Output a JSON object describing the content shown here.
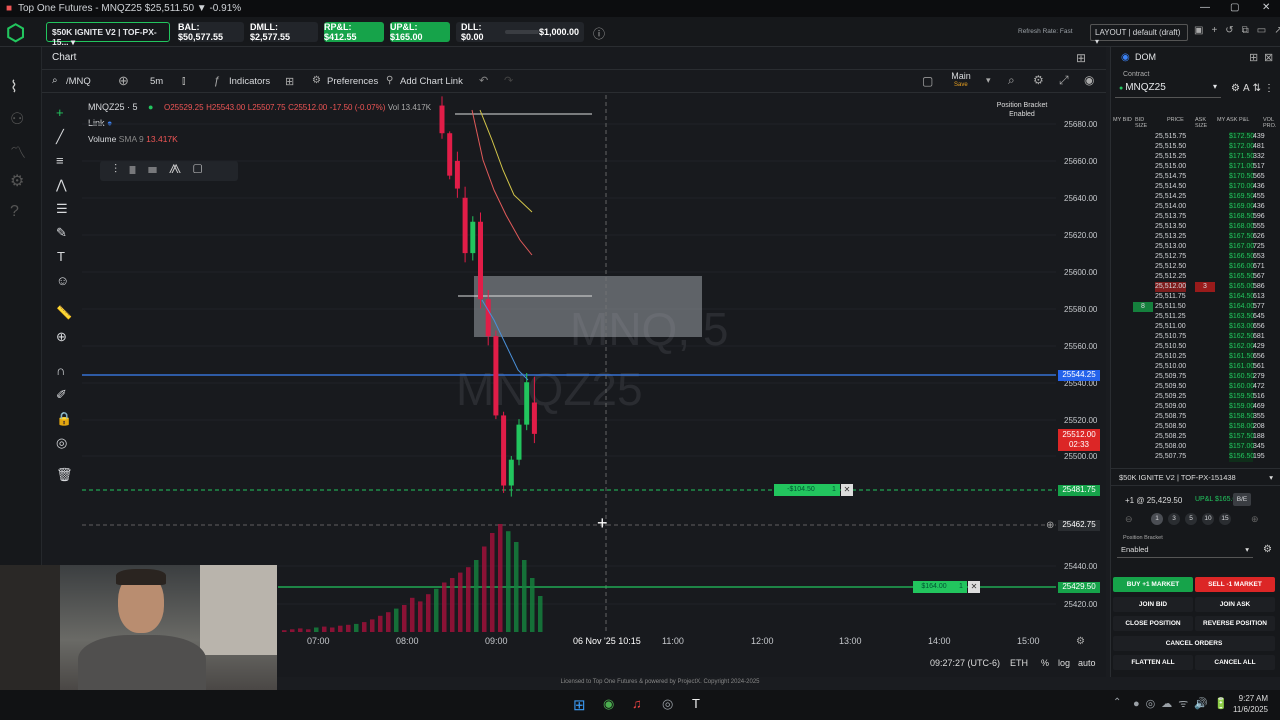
{
  "window": {
    "title": "Top One Futures - MNQZ25 $25,511.50 ▼ -0.91%"
  },
  "topbar": {
    "account": "$50K IGNITE V2 | TOF-PX-15...",
    "bal": "BAL: $50,577.55",
    "dmll": "DMLL: $2,577.55",
    "rpl": "RP&L: $412.55",
    "upl": "UP&L: $165.00",
    "dll": "DLL: $0.00",
    "dll_max": "$1,000.00",
    "refresh": "Refresh Rate: Fast",
    "layout": "LAYOUT | default (draft)"
  },
  "chart_panel": {
    "tab": "Chart",
    "symbol_search": "/MNQ",
    "interval": "5m",
    "indicators": "Indicators",
    "preferences": "Preferences",
    "add_chart_link": "Add Chart Link",
    "main_label": "Main",
    "main_sub": "Save",
    "position_bracket": "Position Bracket",
    "position_bracket_state": "Enabled"
  },
  "legend": {
    "symbol": "MNQZ25 · 5",
    "ohlc_o": "O25529.25",
    "ohlc_h": "H25543.00",
    "ohlc_l": "L25507.75",
    "ohlc_c": "C25512.00",
    "ohlc_change": "-17.50 (-0.07%)",
    "vol": "Vol 13.417K",
    "link": "Link",
    "volume_label": "Volume",
    "volume_sma": "SMA 9",
    "volume_value": "13.417K"
  },
  "watermark": {
    "line1": "MNQ, 5",
    "line2": "MNQZ25"
  },
  "chart_data": {
    "type": "candlestick",
    "symbol": "MNQZ25",
    "price_axis": [
      "25680.00",
      "25660.00",
      "25640.00",
      "25620.00",
      "25600.00",
      "25580.00",
      "25560.00",
      "25540.00",
      "25520.00",
      "25500.00",
      "25440.00",
      "25420.00"
    ],
    "time_axis": [
      "07:00",
      "08:00",
      "09:00",
      "06 Nov '25  10:15",
      "11:00",
      "12:00",
      "13:00",
      "14:00",
      "15:00"
    ],
    "ylim": [
      25415,
      25690
    ],
    "price_labels": {
      "blue_line": "25544.25",
      "last_price": "25512.00",
      "last_countdown": "02:33",
      "green_order": "25481.75",
      "crosshair": "25462.75",
      "bottom_green": "25429.50"
    },
    "order_labels": {
      "upper": "-$104.50",
      "upper_qty": "1",
      "lower": "$164.00",
      "lower_qty": "1"
    },
    "candles": [
      {
        "o": 25690,
        "h": 25695,
        "l": 25672,
        "c": 25675,
        "up": false
      },
      {
        "o": 25675,
        "h": 25676,
        "l": 25650,
        "c": 25652,
        "up": false
      },
      {
        "o": 25660,
        "h": 25665,
        "l": 25640,
        "c": 25645,
        "up": false
      },
      {
        "o": 25640,
        "h": 25646,
        "l": 25605,
        "c": 25610,
        "up": false
      },
      {
        "o": 25610,
        "h": 25630,
        "l": 25606,
        "c": 25627,
        "up": true
      },
      {
        "o": 25627,
        "h": 25632,
        "l": 25580,
        "c": 25585,
        "up": false
      },
      {
        "o": 25585,
        "h": 25590,
        "l": 25560,
        "c": 25565,
        "up": false
      },
      {
        "o": 25565,
        "h": 25568,
        "l": 25520,
        "c": 25522,
        "up": false
      },
      {
        "o": 25522,
        "h": 25524,
        "l": 25480,
        "c": 25484,
        "up": false
      },
      {
        "o": 25484,
        "h": 25500,
        "l": 25478,
        "c": 25498,
        "up": true
      },
      {
        "o": 25498,
        "h": 25520,
        "l": 25495,
        "c": 25517,
        "up": true
      },
      {
        "o": 25517,
        "h": 25545,
        "l": 25514,
        "c": 25540,
        "up": true
      },
      {
        "o": 25529,
        "h": 25543,
        "l": 25507,
        "c": 25512,
        "up": false
      }
    ]
  },
  "dom": {
    "tab": "DOM",
    "contract_label": "Contract",
    "contract": "MNQZ25",
    "headers": [
      "MY BID",
      "BID SIZE",
      "PRICE",
      "ASK SIZE",
      "MY ASK",
      "P&L",
      "VOL PRO."
    ],
    "rows": [
      [
        "25,515.75",
        "$172.50",
        "439"
      ],
      [
        "25,515.50",
        "$172.00",
        "481"
      ],
      [
        "25,515.25",
        "$171.50",
        "332"
      ],
      [
        "25,515.00",
        "$171.00",
        "517"
      ],
      [
        "25,514.75",
        "$170.50",
        "565"
      ],
      [
        "25,514.50",
        "$170.00",
        "436"
      ],
      [
        "25,514.25",
        "$169.50",
        "455"
      ],
      [
        "25,514.00",
        "$169.00",
        "436"
      ],
      [
        "25,513.75",
        "$168.50",
        "596"
      ],
      [
        "25,513.50",
        "$168.00",
        "555"
      ],
      [
        "25,513.25",
        "$167.50",
        "626"
      ],
      [
        "25,513.00",
        "$167.00",
        "725"
      ],
      [
        "25,512.75",
        "$166.50",
        "653"
      ],
      [
        "25,512.50",
        "$166.00",
        "671"
      ],
      [
        "25,512.25",
        "$165.50",
        "567"
      ],
      [
        "25,512.00",
        "$165.00",
        "586"
      ],
      [
        "25,511.75",
        "$164.50",
        "613"
      ],
      [
        "25,511.50",
        "$164.00",
        "577"
      ],
      [
        "25,511.25",
        "$163.50",
        "645"
      ],
      [
        "25,511.00",
        "$163.00",
        "656"
      ],
      [
        "25,510.75",
        "$162.50",
        "681"
      ],
      [
        "25,510.50",
        "$162.00",
        "429"
      ],
      [
        "25,510.25",
        "$161.50",
        "656"
      ],
      [
        "25,510.00",
        "$161.00",
        "561"
      ],
      [
        "25,509.75",
        "$160.50",
        "279"
      ],
      [
        "25,509.50",
        "$160.00",
        "472"
      ],
      [
        "25,509.25",
        "$159.50",
        "516"
      ],
      [
        "25,509.00",
        "$159.00",
        "469"
      ],
      [
        "25,508.75",
        "$158.50",
        "355"
      ],
      [
        "25,508.50",
        "$158.00",
        "208"
      ],
      [
        "25,508.25",
        "$157.50",
        "188"
      ],
      [
        "25,508.00",
        "$157.00",
        "345"
      ],
      [
        "25,507.75",
        "$156.50",
        "195"
      ]
    ],
    "ask_size_highlight": "3",
    "bid_size_highlight": "8",
    "account": "$50K IGNITE V2 | TOF-PX-151438",
    "position": "+1 @ 25,429.50",
    "position_upl": "UP&L $165.00",
    "be": "B/E",
    "qty_options": [
      "1",
      "3",
      "5",
      "10",
      "15"
    ],
    "bracket_label": "Position Bracket",
    "bracket_value": "Enabled",
    "buy_market": "BUY +1 MARKET",
    "sell_market": "SELL -1 MARKET",
    "join_bid": "JOIN BID",
    "join_ask": "JOIN ASK",
    "close_position": "CLOSE POSITION",
    "reverse_position": "REVERSE POSITION",
    "cancel_orders": "CANCEL ORDERS",
    "flatten_all": "FLATTEN ALL",
    "cancel_all": "CANCEL ALL"
  },
  "bottom": {
    "clock": "09:27:27 (UTC-6)",
    "eth": "ETH",
    "pct": "%",
    "log": "log",
    "auto": "auto",
    "license": "Licensed to Top One Futures & powered by ProjectX. Copyright 2024-2025"
  },
  "taskbar": {
    "time": "9:27 AM",
    "date": "11/6/2025"
  },
  "colors": {
    "up": "#22c55e",
    "down": "#e11d48",
    "accent_green": "#16a34a",
    "blue_line": "#3b82f6"
  }
}
